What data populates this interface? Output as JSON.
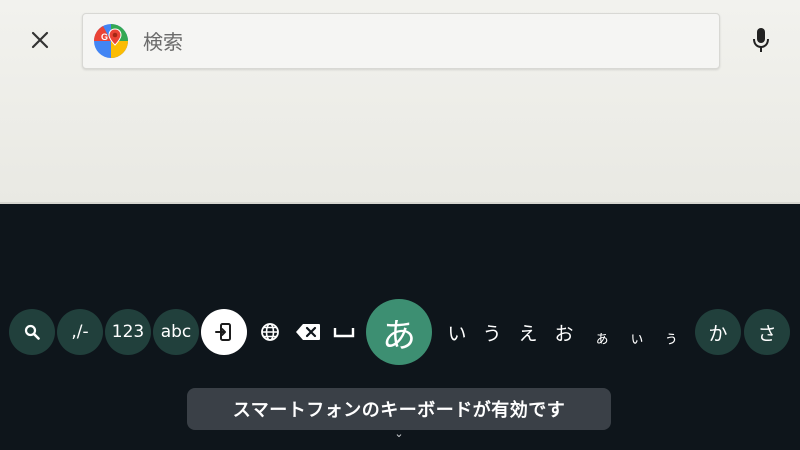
{
  "header": {
    "close_icon": "close-icon",
    "search": {
      "placeholder": "検索",
      "value": ""
    },
    "logo_icon": "google-maps-logo",
    "mic_icon": "microphone-icon"
  },
  "keyboard": {
    "keys": [
      {
        "id": "search",
        "icon": "search-icon"
      },
      {
        "id": "symbols",
        "label": ",/-"
      },
      {
        "id": "numbers",
        "label": "123"
      },
      {
        "id": "alpha",
        "label": "abc"
      },
      {
        "id": "input-mode",
        "icon": "input-switch-icon"
      },
      {
        "id": "language",
        "icon": "globe-icon"
      },
      {
        "id": "backspace",
        "icon": "backspace-icon"
      },
      {
        "id": "space",
        "icon": "space-icon"
      },
      {
        "id": "a",
        "label": "あ"
      },
      {
        "id": "i",
        "label": "い"
      },
      {
        "id": "u",
        "label": "う"
      },
      {
        "id": "e",
        "label": "え"
      },
      {
        "id": "o",
        "label": "お"
      },
      {
        "id": "small-a",
        "label": "ぁ"
      },
      {
        "id": "small-i",
        "label": "ぃ"
      },
      {
        "id": "small-u",
        "label": "ぅ"
      },
      {
        "id": "ka",
        "label": "か"
      },
      {
        "id": "sa",
        "label": "さ"
      }
    ],
    "colors": {
      "background": "#0e151b",
      "key": "#21403c",
      "selected_key": "#3d8f72"
    }
  },
  "toast": {
    "message": "スマートフォンのキーボードが有効です"
  }
}
